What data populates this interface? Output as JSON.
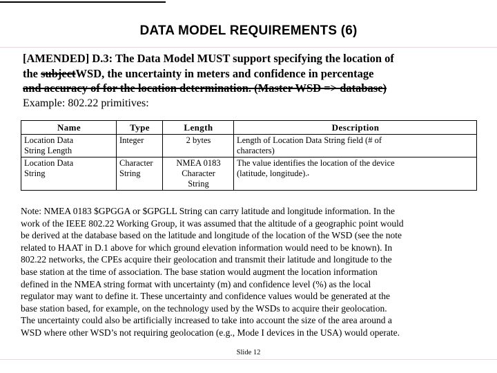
{
  "slide": {
    "title": "DATA MODEL REQUIREMENTS (6)",
    "number_label": "Slide 12"
  },
  "requirement": {
    "line1": "[AMENDED] D.3: The Data Model MUST support specifying the location of",
    "line2_prefix": "the ",
    "line2_struck": "subject",
    "line2_suffix": "WSD, the uncertainty in meters and confidence in percentage",
    "line3_struck": "and accuracy of for the location determination. (Master WSD => database)"
  },
  "example": {
    "label": "Example: 802.22 primitives:"
  },
  "table": {
    "headers": [
      "Name",
      "Type",
      "Length",
      "Description"
    ],
    "rows": [
      {
        "name": [
          "Location Data",
          "String Length"
        ],
        "type": [
          "Integer"
        ],
        "length": [
          "2 bytes"
        ],
        "description": [
          "Length of Location Data String field (# of",
          "characters)"
        ],
        "description_mark": ""
      },
      {
        "name": [
          "Location Data",
          "String"
        ],
        "type": [
          "Character",
          "String"
        ],
        "length": [
          "NMEA 0183",
          "Character",
          "String"
        ],
        "description": [
          "The value identifies the location of the device",
          "(latitude, longitude)."
        ],
        "description_mark": "▪"
      }
    ]
  },
  "note": {
    "lines": [
      "Note: NMEA 0183 $GPGGA or $GPGLL String can carry latitude and longitude information. In the",
      "work of the IEEE 802.22 Working Group, it was assumed that the altitude of a geographic point would",
      "be derived at the database based on the latitude and longitude of the location of the WSD (see the note",
      "related to HAAT in D.1 above for which ground elevation information would need to be known). In",
      "802.22 networks, the CPEs acquire their geolocation and transmit their latitude and longitude to the",
      "base station at the time of association. The base station would augment the location information",
      "defined in the NMEA string format with uncertainty (m) and confidence level (%) as the local",
      "regulator may want to define it.  These uncertainty and confidence values would be generated at the",
      "base station based, for example, on the technology used by the WSDs to acquire their geolocation.",
      "The uncertainty could also be artificially increased to take into account the size of the area around a",
      "WSD where other WSD’s not requiring geolocation (e.g., Mode I devices in the USA) would operate."
    ]
  },
  "colors": {
    "text": "#000000",
    "rule": "#000000",
    "change_rule": "#f3d7d7",
    "background": "#ffffff"
  }
}
